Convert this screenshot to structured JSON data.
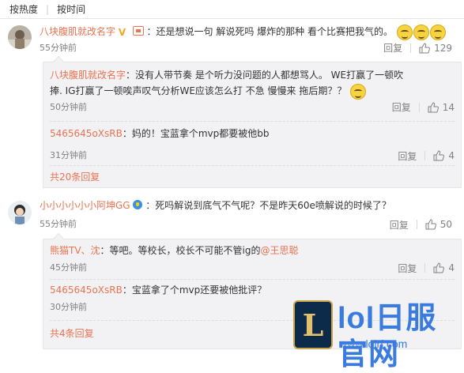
{
  "sort": {
    "hot": "按热度",
    "time": "按时间"
  },
  "c1": {
    "user": "八块腹肌就改名字",
    "text": "：还是想说一句 解说死吗 爆炸的那种 看个比赛把我气的。",
    "time": "55分钟前",
    "reply_label": "回复",
    "likes": "129"
  },
  "c1_replies": [
    {
      "user": "八块腹肌就改名字",
      "text1": "：没有人带节奏  是个听力没问题的人都想骂人。  WE打赢了一顿吹",
      "text2": "捧. IG打赢了一顿唉声叹气分析WE应该怎么打 不急 慢慢来 拖后期？？",
      "time": "50分钟前",
      "reply_label": "回复",
      "likes": "14"
    },
    {
      "user": "5465645oXsRB",
      "text": "：妈的！宝蓝拿个mvp都要被他bb",
      "time": "31分钟前",
      "reply_label": "回复",
      "likes": "4"
    }
  ],
  "c1_more": "共20条回复",
  "c2": {
    "user": "小小小小小小阿坤GG",
    "text": "：死吗解说到底气不气呢？不是昨天60e喷解说的时候了？",
    "time": "55分钟前",
    "reply_label": "回复",
    "likes": "50"
  },
  "c2_replies": [
    {
      "user": "熊猫TV、沈",
      "text": "：等吧。等校长，校长不可能不管ig的",
      "mention": "@王思聪",
      "time": "45分钟前",
      "reply_label": "回复",
      "likes": "4"
    },
    {
      "user": "5465645oXsRB",
      "text": "：宝蓝拿了个mvp还要被他批评？",
      "time": "30分钟前",
      "reply_label": "回复",
      "likes": ""
    }
  ],
  "c2_more": "共4条回复",
  "watermark": {
    "logo": "L",
    "title": "lol日服官网",
    "url": "www.lolrf.com"
  },
  "colors": {
    "link": "#eb7350",
    "meta": "#808080",
    "reply_bg": "#f2f2f5"
  }
}
